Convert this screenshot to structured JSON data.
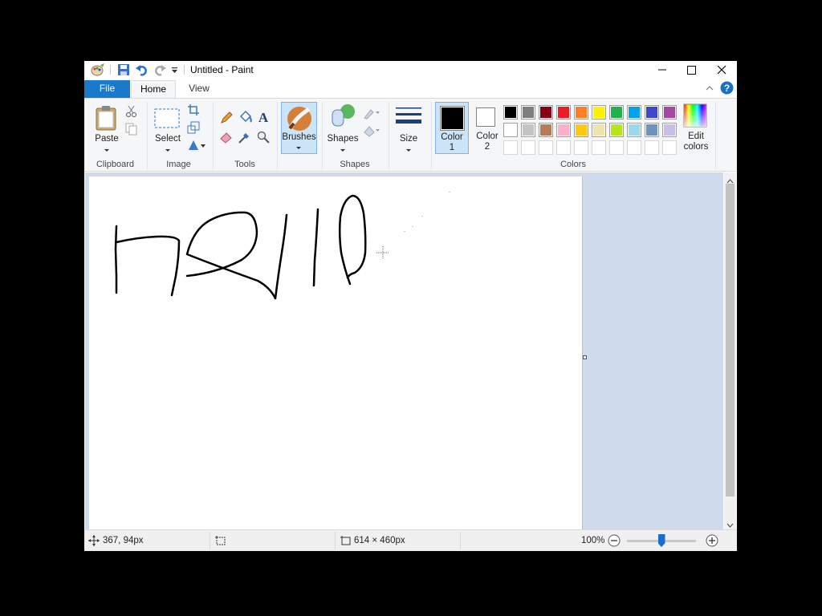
{
  "window": {
    "title": "Untitled - Paint"
  },
  "tabs": {
    "file": "File",
    "home": "Home",
    "view": "View"
  },
  "ribbon": {
    "clipboard": {
      "paste_label": "Paste",
      "group_label": "Clipboard"
    },
    "image": {
      "select_label": "Select",
      "group_label": "Image"
    },
    "tools": {
      "group_label": "Tools"
    },
    "brushes": {
      "label": "Brushes"
    },
    "shapes": {
      "label": "Shapes",
      "group_label": "Shapes"
    },
    "size": {
      "label": "Size"
    },
    "colors": {
      "color1_label_line1": "Color",
      "color1_label_line2": "1",
      "color2_label_line1": "Color",
      "color2_label_line2": "2",
      "edit_label_line1": "Edit",
      "edit_label_line2": "colors",
      "group_label": "Colors",
      "color1_value": "#000000",
      "color2_value": "#ffffff",
      "palette_row1": [
        "#000000",
        "#7f7f7f",
        "#880015",
        "#ed1c24",
        "#ff7f27",
        "#fff200",
        "#22b14c",
        "#00a2e8",
        "#3f48cc",
        "#a349a4"
      ],
      "palette_row2": [
        "#ffffff",
        "#c3c3c3",
        "#b97a57",
        "#ffaec9",
        "#ffc90e",
        "#efe4b0",
        "#b5e61d",
        "#99d9ea",
        "#7092be",
        "#c8bfe7"
      ],
      "palette_row3": [
        "#ffffff",
        "#ffffff",
        "#ffffff",
        "#ffffff",
        "#ffffff",
        "#ffffff",
        "#ffffff",
        "#ffffff",
        "#ffffff",
        "#ffffff"
      ]
    }
  },
  "status": {
    "cursor_pos": "367, 94px",
    "image_size": "614 × 460px",
    "zoom": "100%",
    "zoom_level_fraction": 0.5
  },
  "icons": {
    "app": "paint-palette-icon",
    "save": "save-icon",
    "undo": "undo-icon",
    "redo": "redo-icon",
    "help": "help-icon"
  },
  "accent_color": "#1979ca"
}
